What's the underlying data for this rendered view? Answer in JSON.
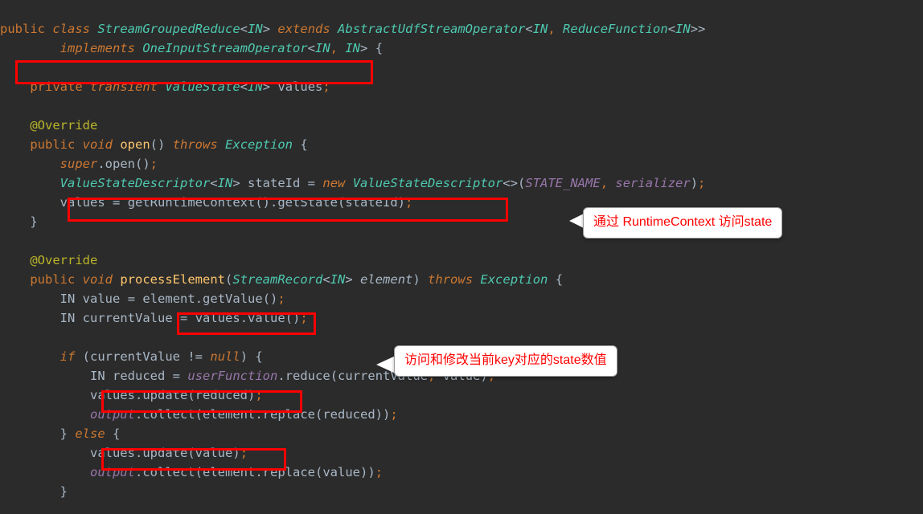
{
  "code": {
    "l1_public": "public",
    "l1_class": "class",
    "l1_name": "StreamGroupedReduce",
    "l1_in": "IN",
    "l1_extends": "extends",
    "l1_abstract": "AbstractUdfStreamOperator",
    "l1_reduce": "ReduceFunction",
    "l2_implements": "implements",
    "l2_oneinput": "OneInputStreamOperator",
    "l4_private": "private",
    "l4_transient": "transient",
    "l4_valuestate": "ValueState",
    "l4_values": "values",
    "l6_override": "@Override",
    "l7_public": "public",
    "l7_void": "void",
    "l7_open": "open",
    "l7_throws": "throws",
    "l7_exception": "Exception",
    "l8_super": "super",
    "l8_open": "open",
    "l9_vsd": "ValueStateDescriptor",
    "l9_stateid": "stateId",
    "l9_new": "new",
    "l9_statename": "STATE_NAME",
    "l9_serializer": "serializer",
    "l10_values": "values",
    "l10_getrc": "getRuntimeContext",
    "l10_getstate": "getState",
    "l10_stateid": "stateId",
    "l13_override": "@Override",
    "l14_public": "public",
    "l14_void": "void",
    "l14_process": "processElement",
    "l14_streamrec": "StreamRecord",
    "l14_element": "element",
    "l14_throws": "throws",
    "l14_exception": "Exception",
    "l15_in": "IN",
    "l15_value": "value",
    "l15_element": "element",
    "l15_getvalue": "getValue",
    "l16_in": "IN",
    "l16_cv": "currentValue",
    "l16_values": "values",
    "l16_value": "value",
    "l18_if": "if",
    "l18_cv": "currentValue",
    "l18_null": "null",
    "l19_in": "IN",
    "l19_reduced": "reduced",
    "l19_uf": "userFunction",
    "l19_reduce": "reduce",
    "l19_cv": "currentValue",
    "l19_value": "value",
    "l20_values": "values",
    "l20_update": "update",
    "l20_reduced": "reduced",
    "l21_output": "output",
    "l21_collect": "collect",
    "l21_element": "element",
    "l21_replace": "replace",
    "l21_reduced": "reduced",
    "l22_else": "else",
    "l23_values": "values",
    "l23_update": "update",
    "l23_value": "value",
    "l24_output": "output",
    "l24_collect": "collect",
    "l24_element": "element",
    "l24_replace": "replace",
    "l24_value": "value"
  },
  "callouts": {
    "c1": "通过 RuntimeContext 访问state",
    "c2": "访问和修改当前key对应的state数值"
  }
}
